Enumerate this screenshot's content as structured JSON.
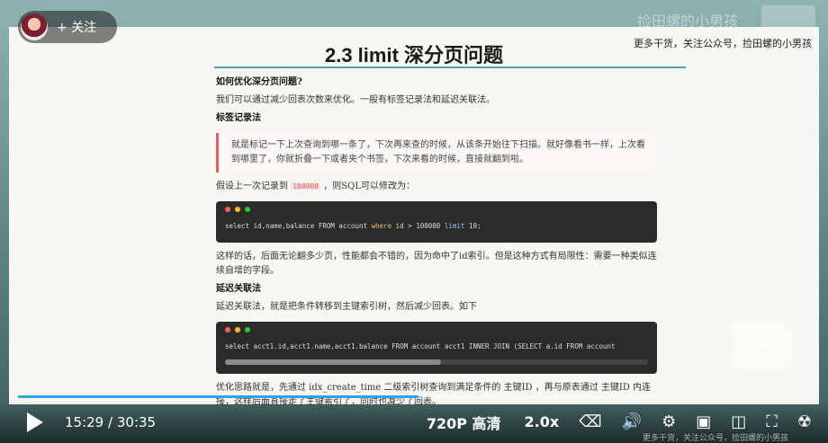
{
  "player": {
    "follow_label": "+ 关注",
    "watermark_top": "捡田螺的小男孩",
    "watermark": "更多干货，关注公众号，捡田螺的小男孩",
    "current_time": "15:29",
    "separator": "/",
    "duration": "30:35",
    "progress": 0.506,
    "quality": "720P 高清",
    "speed": "2.0x",
    "bottom_watermark": "更多干货，关注公众号，捡田螺的小男孩",
    "icons": [
      "play-icon",
      "danmaku-off-icon",
      "subtitle-icon",
      "volume-icon",
      "settings-icon",
      "pip-icon",
      "widescreen-icon",
      "fullscreen-icon",
      "logo-icon"
    ]
  },
  "slide": {
    "title": "2.3 limit 深分页问题",
    "q_heading": "如何优化深分页问题?",
    "intro": "我们可以通过减少回表次数来优化。一般有标签记录法和延迟关联法。",
    "tag_heading": "标签记录法",
    "quote": "就是标记一下上次查询到哪一条了，下次再来查的时候，从该条开始往下扫描。就好像看书一样，上次看到哪里了，你就折叠一下或者夹个书签，下次来看的时候，直接就翻到啦。",
    "assume_pre": "假设上一次记录到",
    "assume_code": "100000",
    "assume_post": "，则SQL可以修改为：",
    "code1": {
      "select": "select",
      "cols": " id,name,balance FROM account ",
      "where": "where",
      "cond": " id > 100000 ",
      "limit": "limit",
      "n": " 10;"
    },
    "after_code": "这样的话，后面无论翻多少页，性能都会不错的，因为命中了id索引。但是这种方式有局限性：需要一种类似连续自增的字段。",
    "delay_heading": "延迟关联法",
    "delay_text": "延迟关联法，就是把条件转移到主键索引树，然后减少回表。如下",
    "code2": "select  acct1.id,acct1.name,acct1.balance FROM account acct1 INNER JOIN (SELECT a.id FROM account",
    "opt_text": "优化思路就是，先通过 idx_create_time 二级索引树查询到满足条件的 主键ID ，再与原表通过 主键ID 内连接，这样后面直接走了主键索引了，同时也减少了回表。"
  },
  "colors": {
    "accent": "#2fa3e8",
    "quote_border": "#e06060",
    "rule": "#4aa6a0"
  }
}
